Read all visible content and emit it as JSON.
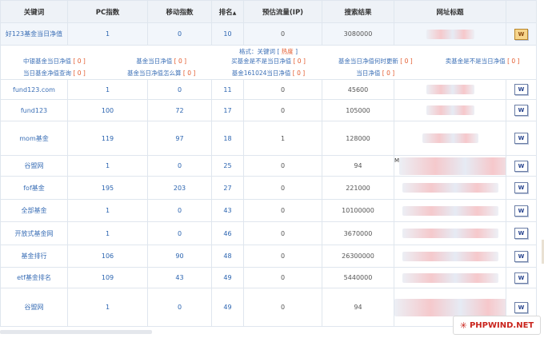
{
  "headers": {
    "keyword": "关键词",
    "pc_index": "PC指数",
    "mobile_index": "移动指数",
    "rank": "排名",
    "rank_sort_icon": "sort-ascending-icon",
    "traffic": "预估流量(IP)",
    "results": "搜索结果",
    "url_title": "网址标题",
    "extra": ""
  },
  "main_row": {
    "keyword": "好123基金当日净值",
    "pc": "1",
    "mobile": "0",
    "rank": "10",
    "traffic": "0",
    "results": "3080000",
    "icon": "snapshot-icon"
  },
  "related": {
    "format_prefix": "格式：关键词 [ ",
    "format_hot": "热度",
    "format_suffix": " ]",
    "items": [
      {
        "text": "中银基金当日净值",
        "count": "0"
      },
      {
        "text": "基金当日净值",
        "count": "0"
      },
      {
        "text": "买基金是不是当日净值",
        "count": "0"
      },
      {
        "text": "基金当日净值何时更新",
        "count": "0"
      },
      {
        "text": "卖基金是不是当日净值",
        "count": "0"
      },
      {
        "text": "当日基金净值查询",
        "count": "0"
      },
      {
        "text": "基金当日净值怎么算",
        "count": "0"
      },
      {
        "text": "基金161024当日净值",
        "count": "0"
      },
      {
        "text": "当日净值",
        "count": "0"
      }
    ]
  },
  "rows": [
    {
      "keyword": "fund123.com",
      "pc": "1",
      "mobile": "0",
      "rank": "11",
      "traffic": "0",
      "results": "45600",
      "title_prefix": ""
    },
    {
      "keyword": "fund123",
      "pc": "100",
      "mobile": "72",
      "rank": "17",
      "traffic": "0",
      "results": "105000",
      "title_prefix": ""
    },
    {
      "keyword": "mom基金",
      "pc": "119",
      "mobile": "97",
      "rank": "18",
      "traffic": "1",
      "results": "128000",
      "title_prefix": ""
    },
    {
      "keyword": "谷盟网",
      "pc": "1",
      "mobile": "0",
      "rank": "25",
      "traffic": "0",
      "results": "94",
      "title_prefix": "M"
    },
    {
      "keyword": "fof基金",
      "pc": "195",
      "mobile": "203",
      "rank": "27",
      "traffic": "0",
      "results": "221000",
      "title_prefix": ""
    },
    {
      "keyword": "全部基金",
      "pc": "1",
      "mobile": "0",
      "rank": "43",
      "traffic": "0",
      "results": "10100000",
      "title_prefix": ""
    },
    {
      "keyword": "开放式基金网",
      "pc": "1",
      "mobile": "0",
      "rank": "46",
      "traffic": "0",
      "results": "3670000",
      "title_prefix": ""
    },
    {
      "keyword": "基金排行",
      "pc": "106",
      "mobile": "90",
      "rank": "48",
      "traffic": "0",
      "results": "26300000",
      "title_prefix": ""
    },
    {
      "keyword": "etf基金排名",
      "pc": "109",
      "mobile": "43",
      "rank": "49",
      "traffic": "0",
      "results": "5440000",
      "title_prefix": ""
    },
    {
      "keyword": "谷盟网",
      "pc": "1",
      "mobile": "0",
      "rank": "49",
      "traffic": "0",
      "results": "94",
      "title_prefix": ""
    }
  ],
  "row_icon_label": "W",
  "main_icon_label": "W",
  "watermark": {
    "star": "✳",
    "text": "PHPWIND.NET"
  }
}
